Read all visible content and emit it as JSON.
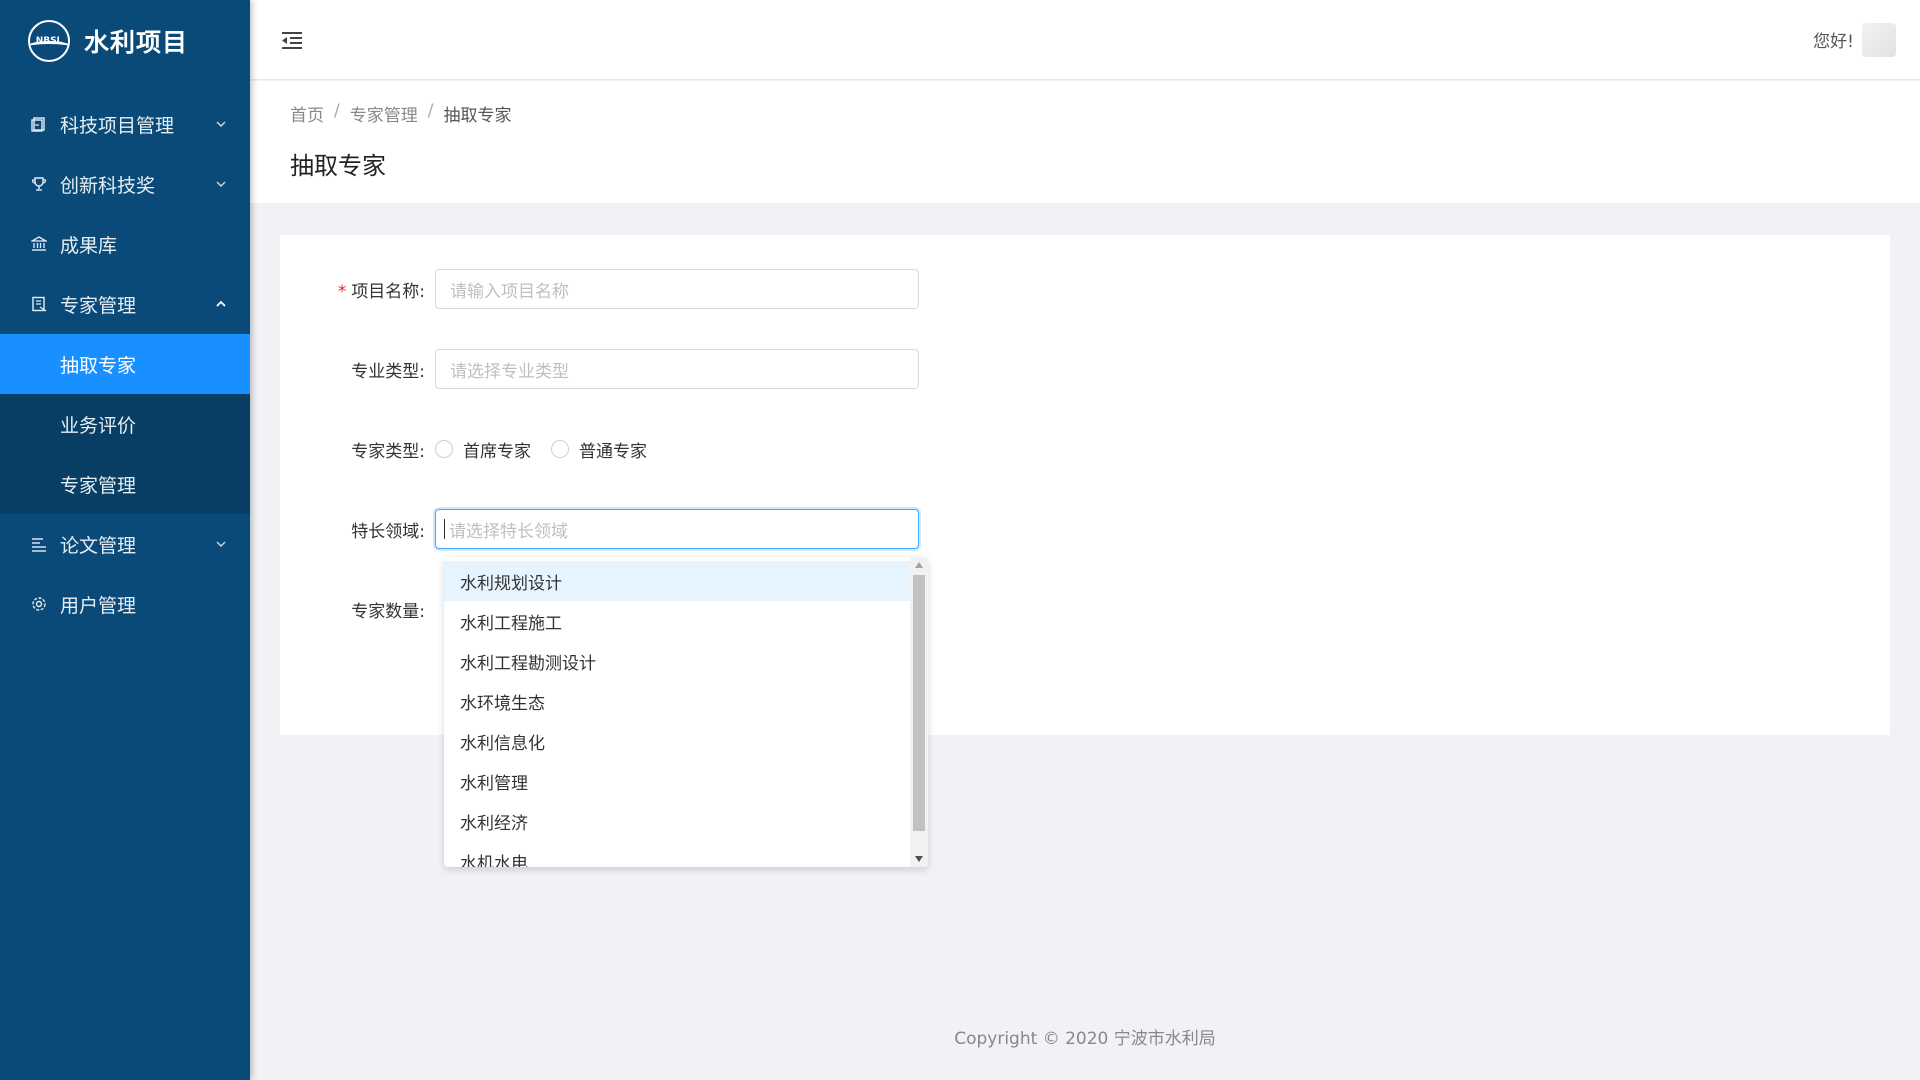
{
  "app": {
    "logo_text": "NBSL",
    "title": "水利项目"
  },
  "sidebar": {
    "items": [
      {
        "label": "科技项目管理",
        "icon": "document-icon",
        "expandable": true
      },
      {
        "label": "创新科技奖",
        "icon": "trophy-icon",
        "expandable": true
      },
      {
        "label": "成果库",
        "icon": "bank-icon",
        "expandable": false
      },
      {
        "label": "专家管理",
        "icon": "id-card-icon",
        "expandable": true,
        "expanded": true,
        "children": [
          {
            "label": "抽取专家",
            "active": true
          },
          {
            "label": "业务评价"
          },
          {
            "label": "专家管理"
          }
        ]
      },
      {
        "label": "论文管理",
        "icon": "list-icon",
        "expandable": true
      },
      {
        "label": "用户管理",
        "icon": "gear-icon",
        "expandable": false
      }
    ]
  },
  "header": {
    "greeting": "您好!"
  },
  "breadcrumb": [
    "首页",
    "专家管理",
    "抽取专家"
  ],
  "page": {
    "title": "抽取专家"
  },
  "form": {
    "project_name": {
      "label": "项目名称:",
      "placeholder": "请输入项目名称",
      "required": true
    },
    "major_type": {
      "label": "专业类型:",
      "placeholder": "请选择专业类型"
    },
    "expert_type": {
      "label": "专家类型:",
      "options": [
        "首席专家",
        "普通专家"
      ]
    },
    "specialty": {
      "label": "特长领域:",
      "placeholder": "请选择特长领域"
    },
    "count": {
      "label": "专家数量:"
    }
  },
  "dropdown": {
    "options": [
      "水利规划设计",
      "水利工程施工",
      "水利工程勘测设计",
      "水环境生态",
      "水利信息化",
      "水利管理",
      "水利经济",
      "水机水电"
    ],
    "highlighted_index": 0
  },
  "footer": {
    "copyright": "Copyright © 2020 宁波市水利局"
  },
  "colors": {
    "sidebar": "#0a4a78",
    "active": "#1890ff",
    "required": "#f5222d"
  }
}
